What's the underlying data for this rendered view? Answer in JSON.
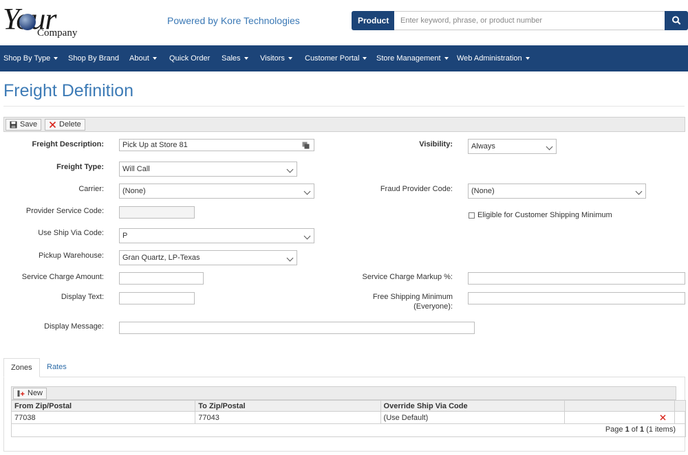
{
  "header": {
    "logo_word": "Your",
    "logo_sub": "Company",
    "powered_by": "Powered by Kore Technologies",
    "search": {
      "category": "Product",
      "placeholder": "Enter keyword, phrase, or product number",
      "icon": "search-icon"
    }
  },
  "nav": {
    "items": [
      {
        "label": "Shop By Type",
        "dropdown": true
      },
      {
        "label": "Shop By Brand",
        "dropdown": false
      },
      {
        "label": "About",
        "dropdown": true
      },
      {
        "label": "Quick Order",
        "dropdown": false
      },
      {
        "label": "Sales",
        "dropdown": true
      },
      {
        "label": "Visitors",
        "dropdown": true
      },
      {
        "label": "Customer Portal",
        "dropdown": true
      },
      {
        "label": "Store Management",
        "dropdown": true
      },
      {
        "label": "Web Administration",
        "dropdown": true
      }
    ]
  },
  "page": {
    "title": "Freight Definition"
  },
  "toolbar": {
    "save_label": "Save",
    "delete_label": "Delete"
  },
  "form": {
    "freight_description": {
      "label": "Freight Description:",
      "value": "Pick Up at Store 81"
    },
    "visibility": {
      "label": "Visibility:",
      "value": "Always"
    },
    "freight_type": {
      "label": "Freight Type:",
      "value": "Will Call"
    },
    "carrier": {
      "label": "Carrier:",
      "value": "(None)"
    },
    "fraud_provider_code": {
      "label": "Fraud Provider Code:",
      "value": "(None)"
    },
    "provider_service_code": {
      "label": "Provider Service Code:",
      "value": ""
    },
    "eligible_shipping_minimum": {
      "label": "Eligible for Customer Shipping Minimum",
      "checked": false
    },
    "use_ship_via_code": {
      "label": "Use Ship Via Code:",
      "value": "P"
    },
    "pickup_warehouse": {
      "label": "Pickup Warehouse:",
      "value": "Gran Quartz, LP-Texas"
    },
    "service_charge_amount": {
      "label": "Service Charge Amount:",
      "value": ""
    },
    "service_charge_markup": {
      "label": "Service Charge Markup %:",
      "value": ""
    },
    "display_text": {
      "label": "Display Text:",
      "value": ""
    },
    "free_shipping_minimum": {
      "label_line1": "Free Shipping Minimum",
      "label_line2": "(Everyone):",
      "value": ""
    },
    "display_message": {
      "label": "Display Message:",
      "value": ""
    }
  },
  "tabs": [
    {
      "label": "Zones",
      "active": true
    },
    {
      "label": "Rates",
      "active": false
    }
  ],
  "zones": {
    "new_label": "New",
    "columns": [
      "From Zip/Postal",
      "To Zip/Postal",
      "Override Ship Via Code",
      ""
    ],
    "rows": [
      {
        "from": "77038",
        "to": "77043",
        "override": "(Use Default)"
      }
    ],
    "pager": {
      "prefix": "Page",
      "current": "1",
      "of": "of",
      "total": "1",
      "items": "(1 items)"
    }
  },
  "colors": {
    "brand_navy": "#1c4478",
    "title_blue": "#3d7bb6",
    "delete_red": "#d9261c"
  }
}
